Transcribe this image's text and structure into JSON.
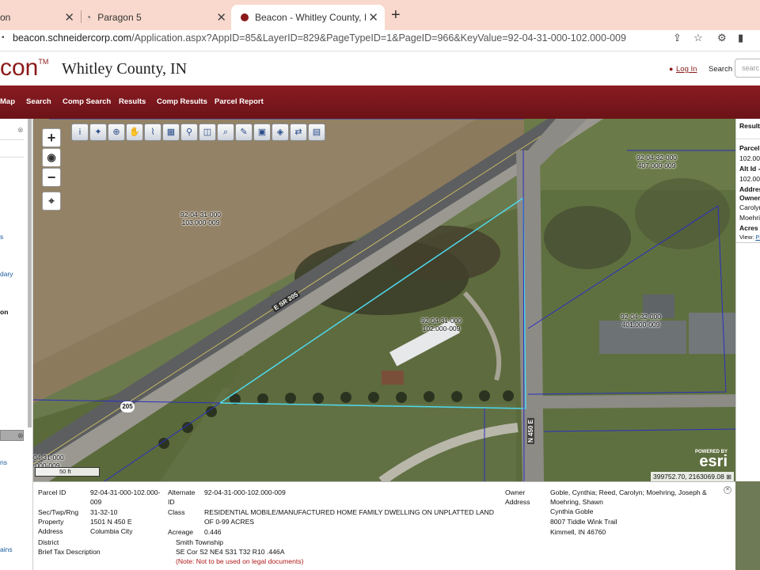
{
  "browser": {
    "tabs": [
      {
        "title": "on"
      },
      {
        "title": "Paragon 5"
      },
      {
        "title": "Beacon - Whitley County, IN - "
      }
    ],
    "new_tab": "+",
    "url_host": "beacon.schneidercorp.com",
    "url_path": "/Application.aspx?AppID=85&LayerID=829&PageTypeID=1&PageID=966&KeyValue=92-04-31-000-102.000-009"
  },
  "header": {
    "logo": "con",
    "logo_tm": "TM",
    "county": "Whitley County, IN",
    "login": "Log In",
    "search": "Search",
    "search_placeholder": "searc"
  },
  "nav": {
    "items": [
      "Map",
      "Search",
      "Comp Search",
      "Results",
      "Comp Results",
      "Parcel Report"
    ]
  },
  "left_panel": {
    "items": [
      "s",
      "dary",
      "on",
      "ns",
      "ains"
    ]
  },
  "map": {
    "toolbar_icons": [
      "info-icon",
      "identify-icon",
      "zoom-in-icon",
      "pan-icon",
      "measure-icon",
      "select-icon",
      "pin-icon",
      "buffer-icon",
      "find-icon",
      "draw-icon",
      "print-icon",
      "layers-icon",
      "export-icon",
      "save-icon"
    ],
    "zoom_in": "+",
    "zoom_out": "−",
    "parcel_labels": [
      {
        "line1": "92-04-31-000",
        "line2": "103.000-009"
      },
      {
        "line1": "92-04-31-000",
        "line2": "102.000-009"
      },
      {
        "line1": "92-04-32-000",
        "line2": "407.000-009"
      },
      {
        "line1": "92-04-32-000",
        "line2": "401.000-009"
      },
      {
        "line1": "04-31-000",
        "line2": ".000-009"
      }
    ],
    "road_labels": [
      "E SR 205",
      "N 450 E"
    ],
    "shield": "205",
    "scale": "50 ft",
    "esri_powered": "POWERED BY",
    "esri": "esri",
    "coords": "399752.70, 2163069.08"
  },
  "result_panel": {
    "title": "Result",
    "lines": [
      "Parcel",
      "102.00",
      "Alt Id -",
      "102.00",
      "Addres",
      "Owner",
      "Carolyn",
      "Moehri",
      "Acres -"
    ],
    "view_label": "View:",
    "view_link": "Pa"
  },
  "info": {
    "parcel_id_label": "Parcel ID",
    "parcel_id_value": "92-04-31-000-102.000-",
    "parcel_id_value2": "009",
    "alternate_id_label1": "Alternate",
    "alternate_id_label2": "ID",
    "alternate_id_value": "92-04-31-000-102.000-009",
    "sec_label": "Sec/Twp/Rng",
    "sec_value": "31-32-10",
    "class_label": "Class",
    "class_value1": "RESIDENTIAL MOBILE/MANUFACTURED HOME FAMILY DWELLING ON UNPLATTED LAND",
    "class_value2": "OF 0-99 ACRES",
    "property_address_label1": "Property",
    "property_address_label2": "Address",
    "property_address_value1": "1501 N 450 E",
    "property_address_value2": "Columbia City",
    "acreage_label": "Acreage",
    "acreage_value": "0.446",
    "district_label": "District",
    "district_value": "Smith Township",
    "brief_tax_label": "Brief Tax Description",
    "brief_tax_value": "SE Cor S2 NE4 S31 T32 R10 .446A",
    "brief_tax_note": "(Note: Not to be used on legal documents)",
    "owner_label1": "Owner",
    "owner_label2": "Address",
    "owner_value1": "Goble, Cynthia; Reed, Carolyn; Moehring, Joseph &",
    "owner_value2": "Moehring, Shawn",
    "owner_value3": "Cynthia Goble",
    "owner_value4": "8007 Tiddle Wink Trail",
    "owner_value5": "Kimmell, IN 46760"
  }
}
